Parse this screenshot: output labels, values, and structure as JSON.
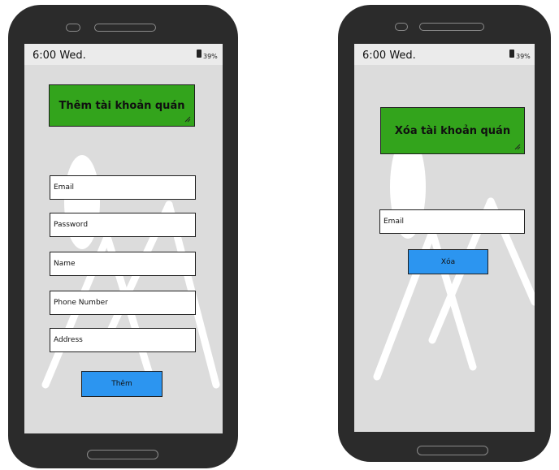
{
  "left_screen": {
    "status": {
      "time": "6:00 Wed.",
      "battery": "39%"
    },
    "title": "Thêm tài khoản quán",
    "fields": [
      {
        "label": "Email"
      },
      {
        "label": "Password"
      },
      {
        "label": "Name"
      },
      {
        "label": "Phone Number"
      },
      {
        "label": "Address"
      }
    ],
    "submit_label": "Thêm"
  },
  "right_screen": {
    "status": {
      "time": "6:00 Wed.",
      "battery": "39%"
    },
    "title": "Xóa tài khoản quán",
    "fields": [
      {
        "label": "Email"
      }
    ],
    "submit_label": "Xóa"
  },
  "colors": {
    "title_bg": "#33a41c",
    "button_bg": "#2c95f0",
    "screen_bg": "#dcdcdc",
    "phone_body": "#2b2b2b"
  }
}
